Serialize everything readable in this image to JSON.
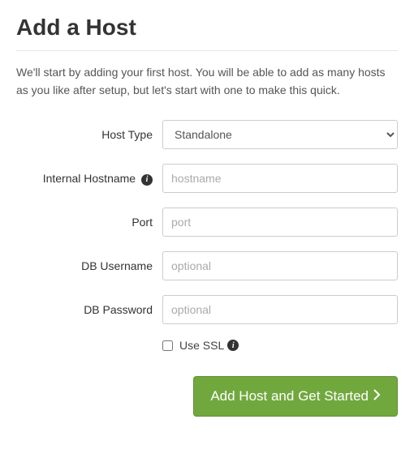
{
  "title": "Add a Host",
  "intro": "We'll start by adding your first host. You will be able to add as many hosts as you like after setup, but let's start with one to make this quick.",
  "form": {
    "host_type": {
      "label": "Host Type",
      "selected": "Standalone"
    },
    "internal_hostname": {
      "label": "Internal Hostname",
      "placeholder": "hostname"
    },
    "port": {
      "label": "Port",
      "placeholder": "port"
    },
    "db_username": {
      "label": "DB Username",
      "placeholder": "optional"
    },
    "db_password": {
      "label": "DB Password",
      "placeholder": "optional"
    },
    "use_ssl": {
      "label": "Use SSL",
      "checked": false
    }
  },
  "submit_label": "Add Host and Get Started"
}
